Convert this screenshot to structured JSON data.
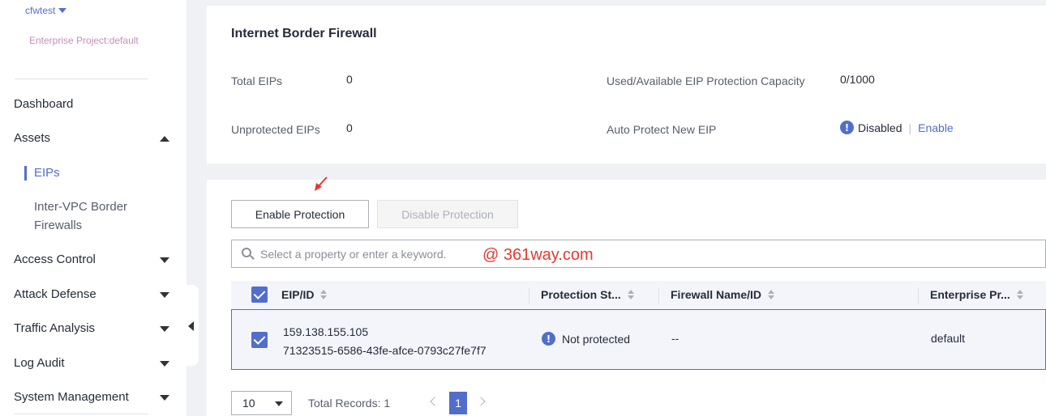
{
  "sidebar": {
    "account": "cfwtest",
    "project": "Enterprise Project:default",
    "items": [
      {
        "label": "Dashboard"
      },
      {
        "label": "Assets"
      },
      {
        "label": "Access Control"
      },
      {
        "label": "Attack Defense"
      },
      {
        "label": "Traffic Analysis"
      },
      {
        "label": "Log Audit"
      },
      {
        "label": "System Management"
      }
    ],
    "sub_items": [
      {
        "label": "EIPs",
        "active": true
      },
      {
        "label": "Inter-VPC Border Firewalls"
      }
    ]
  },
  "summary": {
    "title": "Internet Border Firewall",
    "total_eips_label": "Total EIPs",
    "total_eips_value": "0",
    "unprotected_label": "Unprotected EIPs",
    "unprotected_value": "0",
    "capacity_label": "Used/Available EIP Protection Capacity",
    "capacity_value": "0/1000",
    "auto_protect_label": "Auto Protect New EIP",
    "auto_protect_status": "Disabled",
    "auto_protect_action": "Enable"
  },
  "toolbar": {
    "enable_label": "Enable Protection",
    "disable_label": "Disable Protection"
  },
  "search": {
    "placeholder": "Select a property or enter a keyword."
  },
  "watermark": "@ 361way.com",
  "table": {
    "columns": [
      "EIP/ID",
      "Protection St...",
      "Firewall Name/ID",
      "Enterprise Pr..."
    ],
    "rows": [
      {
        "eip": "159.138.155.105",
        "id": "71323515-6586-43fe-afce-0793c27fe7f7",
        "status": "Not protected",
        "firewall": "--",
        "enterprise": "default"
      }
    ]
  },
  "pagination": {
    "page_size": "10",
    "total": "Total Records: 1",
    "current_page": "1"
  },
  "colors": {
    "accent": "#526ecc",
    "watermark": "#e8382d"
  }
}
